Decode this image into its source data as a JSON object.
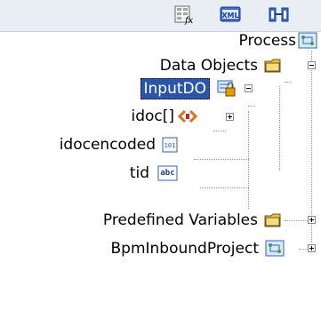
{
  "toolbar": {
    "buttons": [
      {
        "name": "function-icon",
        "label": "fx"
      },
      {
        "name": "xml-icon",
        "label": "XML"
      },
      {
        "name": "mapper-icon",
        "label": ""
      }
    ]
  },
  "tree": {
    "process": "Process",
    "data_objects": "Data Objects",
    "input_do": "InputDO",
    "idoc": "idoc[]",
    "idocencoded": "idocencoded",
    "tid": "tid",
    "tid_type": "abc",
    "predefined": "Predefined Variables",
    "project": "BpmInboundProject"
  },
  "colors": {
    "selection": "#2b55a6",
    "toolbar_bg": "#e9eef5",
    "folder": "#f0c040",
    "xml_icon": "#e07020"
  }
}
